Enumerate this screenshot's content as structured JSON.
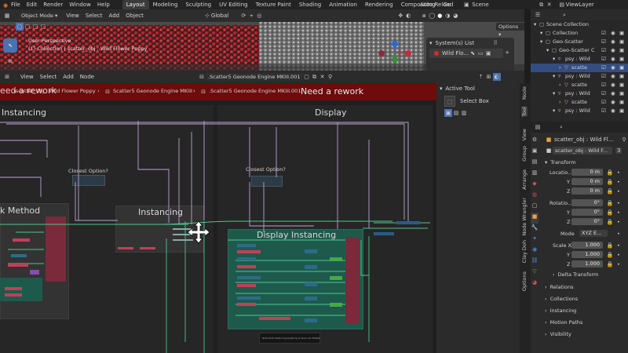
{
  "topbar": {
    "menus": [
      "File",
      "Edit",
      "Render",
      "Window",
      "Help"
    ],
    "workspaces": [
      "Layout",
      "Modeling",
      "Sculpting",
      "UV Editing",
      "Texture Paint",
      "Shading",
      "Animation",
      "Rendering",
      "Compositing",
      "Ge"
    ],
    "active_workspace": "Layout",
    "auto_reload": "Auto Reload",
    "scene_label": "Scene",
    "viewlayer_label": "ViewLayer"
  },
  "viewport": {
    "mode": "Object Mode",
    "menus": [
      "View",
      "Select",
      "Add",
      "Object"
    ],
    "transform": "Global",
    "options": "Options",
    "overlay_title": "User Perspective",
    "overlay_subtitle": "(1) Collection | scatter_obj : Wild Flower Poppy",
    "systems_title": "System(s) List",
    "systems_item": "Wild Flo..."
  },
  "node_editor": {
    "menus": [
      "View",
      "Select",
      "Add",
      "Node"
    ],
    "tree_name": ".Scatter5 Geonode Engine MKIII.001",
    "breadcrumb": [
      "scatter_obj : Wild Flower Poppy",
      "Scatter5 Geonode Engine MKIII",
      ".Scatter5 Geonode Engine MKIII.001"
    ],
    "breadcrumb_overlay_left": "eed a rework",
    "rework": "Need a rework",
    "frames": {
      "instancing_big": "Instancing",
      "display": "Display",
      "method": "k Method",
      "instancing_mid": "Instancing",
      "display_instancing": "Display Instancing"
    },
    "closest_a": "Closest  Option?",
    "closest_b": "Closest  Option?",
    "note": "Note that Instancing anything is done via TRIGGER"
  },
  "sidebar": {
    "active_tool": "Active Tool",
    "tool_name": "Select Box",
    "tabs": [
      "Node",
      "Tool",
      "View",
      "Group",
      "Arrange",
      "Node Wrangler",
      "Clay Doh",
      "Options"
    ]
  },
  "outliner": {
    "rows": [
      {
        "label": "Scene Collection",
        "indent": 0
      },
      {
        "label": "Collection",
        "indent": 1
      },
      {
        "label": "Geo-Scatter",
        "indent": 1
      },
      {
        "label": "Geo-Scatter C",
        "indent": 2
      },
      {
        "label": "psy : Wild",
        "indent": 3
      },
      {
        "label": "scatte",
        "indent": 4
      },
      {
        "label": "psy : Wild",
        "indent": 3
      },
      {
        "label": "scatte",
        "indent": 4
      },
      {
        "label": "psy : Wild",
        "indent": 3
      },
      {
        "label": "scatte",
        "indent": 4
      },
      {
        "label": "psy : Wild",
        "indent": 3
      }
    ]
  },
  "properties": {
    "object_path": "scatter_obj : Wild Fl...",
    "object_name": "scatter_obj : Wild F...",
    "user_count": "3",
    "transform_title": "Transform",
    "location_label": "Locatio...",
    "location": [
      "0 m",
      "0 m",
      "0 m"
    ],
    "rotation_label": "Rotatio...",
    "rotation": [
      "0°",
      "0°",
      "0°"
    ],
    "mode_label": "Mode",
    "mode_value": "XYZ E...",
    "scale_label": "Scale X",
    "scale": [
      "1.000",
      "1.000",
      "1.000"
    ],
    "axis_y": "Y",
    "axis_z": "Z",
    "delta_transform": "Delta Transform",
    "sections": [
      "Relations",
      "Collections",
      "Instancing",
      "Motion Paths",
      "Visibility"
    ]
  },
  "colors": {
    "accent_blue": "#4772b3",
    "rework_red": "#6e0b0b",
    "frame_teal": "#1e5a4c",
    "node_red": "#7a2a3a",
    "wire_purple": "#b9a3d0",
    "wire_green": "#49c98a"
  }
}
